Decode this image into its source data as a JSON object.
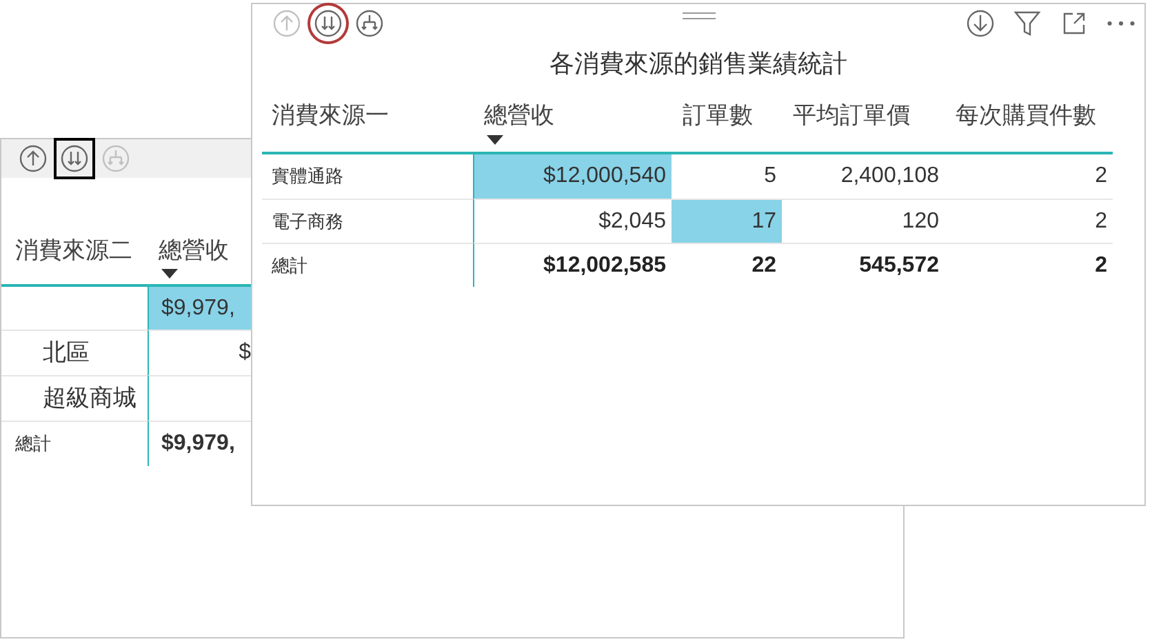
{
  "visuals": [
    {
      "toolbar": [
        {
          "kind": "drill-up",
          "disabled": false,
          "selected": false,
          "focused": false
        },
        {
          "kind": "drill-down",
          "disabled": false,
          "selected": true,
          "focused": true
        },
        {
          "kind": "expand",
          "disabled": true,
          "selected": false,
          "focused": false
        }
      ],
      "table": {
        "columns": [
          {
            "label": "消費來源二",
            "sorted": false
          },
          {
            "label": "總營收",
            "sorted": true
          }
        ],
        "rows": [
          {
            "kind": "data",
            "values": [
              {
                "text": "$9,979,",
                "highlighted": true
              }
            ]
          },
          {
            "kind": "data",
            "label": "北區",
            "values": [
              {
                "text": "$",
                "highlighted": false
              }
            ]
          },
          {
            "kind": "data",
            "label": "超級商城"
          },
          {
            "kind": "total",
            "label": "總計",
            "values": [
              {
                "text": "$9,979,",
                "highlighted": false
              }
            ]
          }
        ]
      }
    },
    {
      "toolbar": [
        {
          "kind": "drill-up",
          "disabled": true,
          "selected": false,
          "focused": false
        },
        {
          "kind": "drill-down",
          "disabled": false,
          "selected": true,
          "focused": false
        },
        {
          "kind": "expand",
          "disabled": false,
          "selected": false,
          "focused": false
        }
      ],
      "actions": [
        {
          "kind": "download"
        },
        {
          "kind": "filter"
        },
        {
          "kind": "focus"
        },
        {
          "kind": "more"
        }
      ],
      "title": "各消費來源的銷售業績統計",
      "table": {
        "columns": [
          {
            "label": "消費來源一",
            "sorted": false
          },
          {
            "label": "總營收",
            "sorted": true
          },
          {
            "label": "訂單數",
            "sorted": false
          },
          {
            "label": "平均訂單價",
            "sorted": false
          },
          {
            "label": "每次購買件數",
            "sorted": false
          }
        ],
        "rows": [
          {
            "kind": "data",
            "label": "實體通路",
            "values": [
              {
                "text": "$12,000,540",
                "highlighted": true
              },
              {
                "text": "5",
                "highlighted": false
              },
              {
                "text": "2,400,108",
                "highlighted": false
              },
              {
                "text": "2",
                "highlighted": false
              }
            ]
          },
          {
            "kind": "data",
            "label": "電子商務",
            "values": [
              {
                "text": "$2,045",
                "highlighted": false
              },
              {
                "text": "17",
                "highlighted": true
              },
              {
                "text": "120",
                "highlighted": false
              },
              {
                "text": "2",
                "highlighted": false
              }
            ]
          },
          {
            "kind": "total",
            "label": "總計",
            "values": [
              {
                "text": "$12,002,585",
                "highlighted": false
              },
              {
                "text": "22",
                "highlighted": false
              },
              {
                "text": "545,572",
                "highlighted": false
              },
              {
                "text": "2",
                "highlighted": false
              }
            ]
          }
        ]
      }
    }
  ]
}
